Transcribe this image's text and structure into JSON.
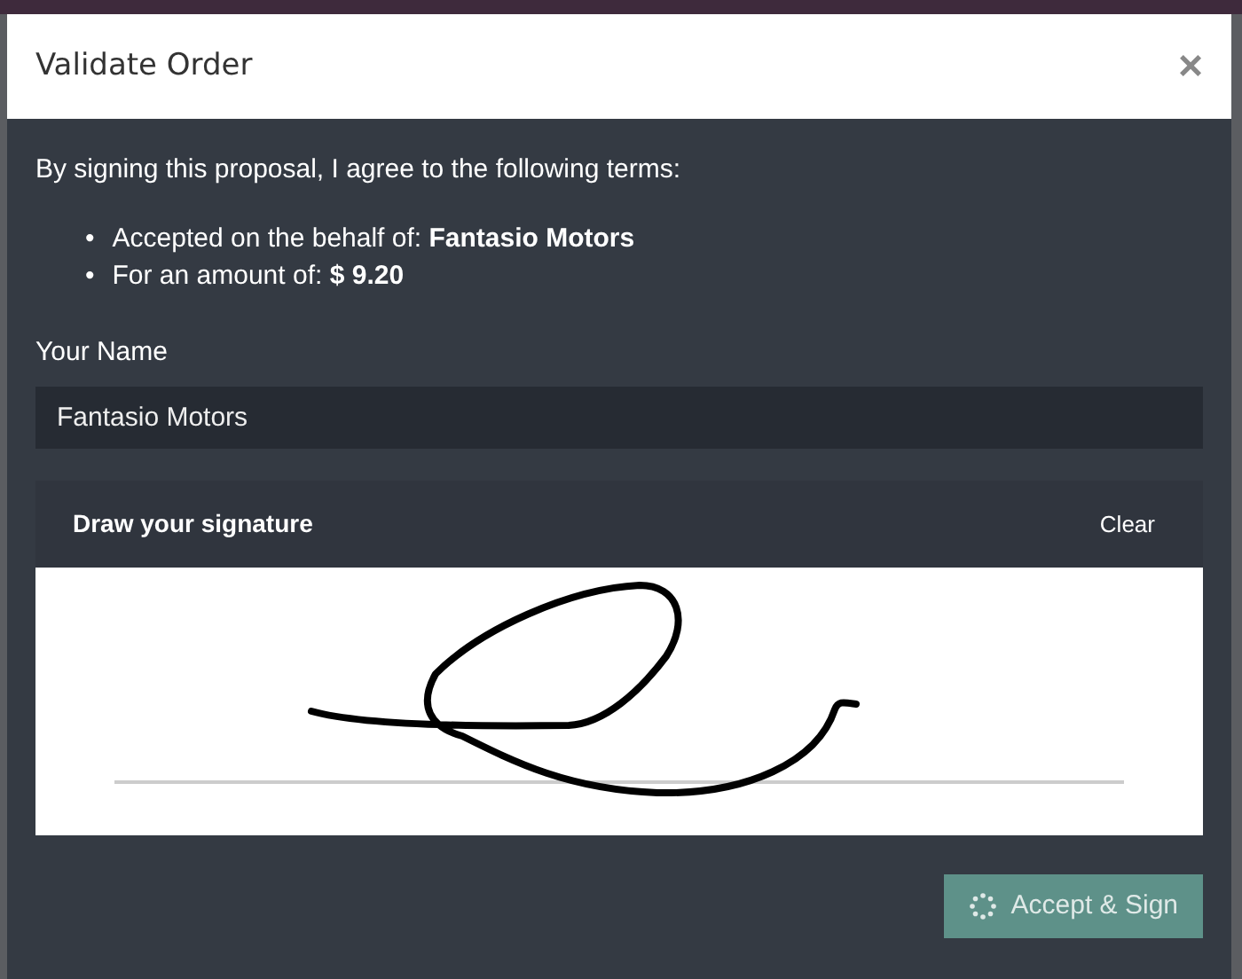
{
  "dialog": {
    "title": "Validate Order",
    "close": "×"
  },
  "intro": "By signing this proposal, I agree to the following terms:",
  "terms": [
    {
      "bullet": "•",
      "text": "Accepted on the behalf of: **Fantasio Motors**"
    },
    {
      "bullet": "•",
      "text": "For an amount of: **$ 9.20**"
    }
  ],
  "name_field": {
    "label": "Your Name",
    "value": "Fantasio Motors"
  },
  "signature": {
    "title": "Draw your signature",
    "clear": "Clear"
  },
  "accept_button": {
    "label": "Accept & Sign",
    "loading": true
  }
}
